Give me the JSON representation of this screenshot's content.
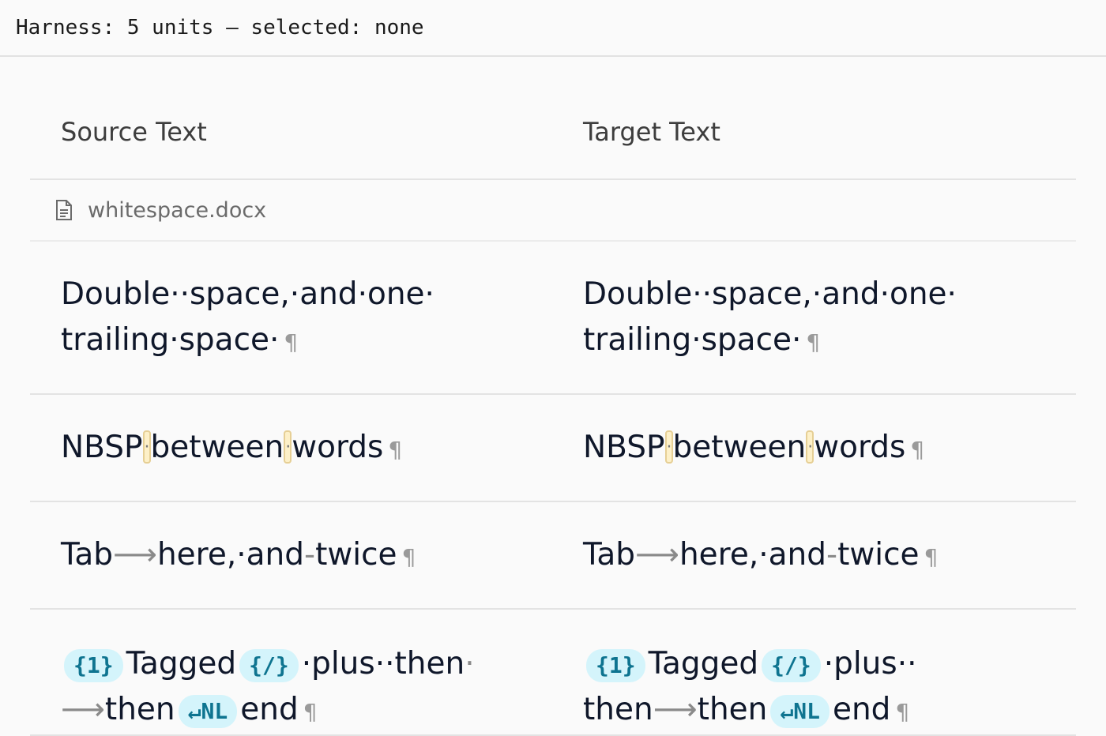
{
  "harness": {
    "label": "Harness: 5 units — selected: none"
  },
  "columns": {
    "source": "Source Text",
    "target": "Target Text"
  },
  "file": {
    "name": "whitespace.docx",
    "icon": "document-icon"
  },
  "glyphs": {
    "space": "·",
    "tab": "⟶",
    "pilcrow": "¶"
  },
  "rows": [
    {
      "source_line1": "Double··space,·and·one·",
      "source_line2": "trailing·space·",
      "target_line1": "Double··space,·and·one·",
      "target_line2": "trailing·space·"
    },
    {
      "source": [
        "NBSP",
        "between",
        "words"
      ],
      "target": [
        "NBSP",
        "between",
        "words"
      ]
    },
    {
      "source_a": "Tab",
      "source_b": "here,·and",
      "source_c": "twice",
      "target_a": "Tab",
      "target_b": "here,·and",
      "target_c": "twice"
    },
    {
      "tag_open": "{1}",
      "tag_close": "{/}",
      "tag_nl": "↵NL",
      "word_tagged": "Tagged",
      "word_plus": "·plus··",
      "word_then": "then",
      "word_end": "end"
    }
  ]
}
